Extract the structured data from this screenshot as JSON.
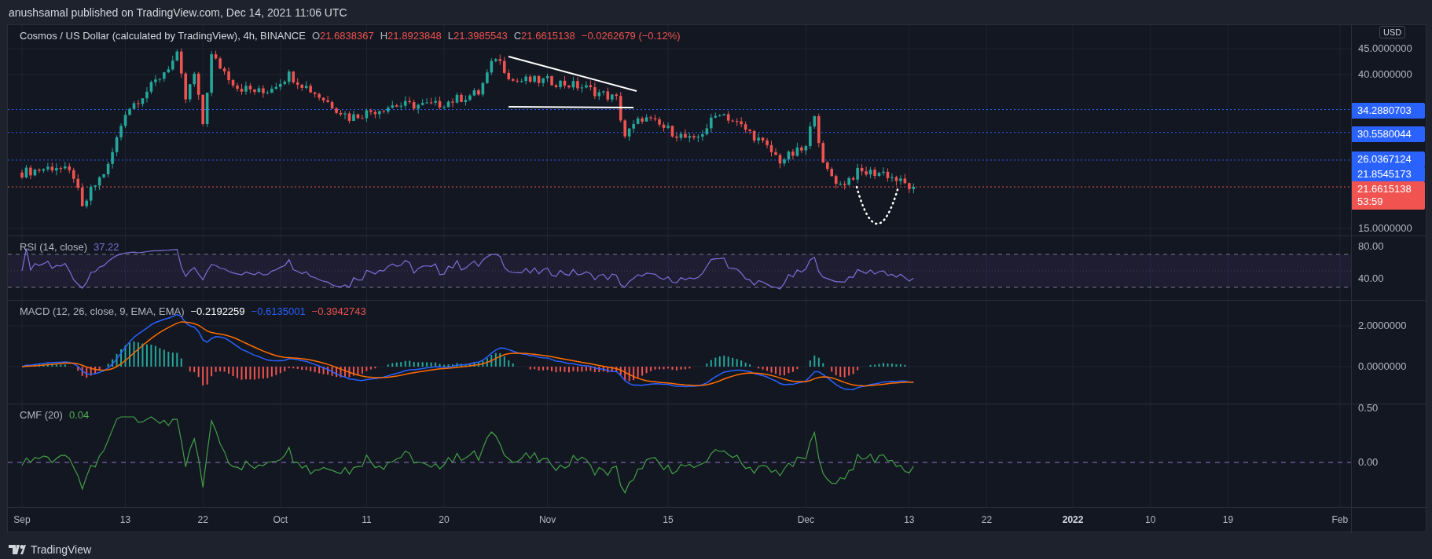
{
  "header": {
    "publisher_line": "anushsamal published on TradingView.com, Dec 14, 2021 11:06 UTC"
  },
  "price_pane": {
    "symbol": "Cosmos / US Dollar (calculated by TradingView), 4h, BINANCE",
    "ohlc": [
      {
        "label": "O",
        "value": "21.6838367"
      },
      {
        "label": "H",
        "value": "21.8923848"
      },
      {
        "label": "L",
        "value": "21.3985543"
      },
      {
        "label": "C",
        "value": "21.6615138"
      }
    ],
    "change": "−0.0262679 (−0.12%)",
    "currency": "USD",
    "ticks": [
      "45.0000000",
      "40.0000000",
      "15.0000000"
    ],
    "tags": [
      {
        "value": "34.2880703",
        "color": "#2962ff"
      },
      {
        "value": "30.5580044",
        "color": "#2962ff"
      },
      {
        "value": "26.0367124",
        "color": "#2962ff"
      },
      {
        "value": "21.8545173",
        "color": "#2962ff"
      },
      {
        "value": "21.6615138",
        "countdown": "53:59",
        "color": "#f05350"
      }
    ]
  },
  "rsi_pane": {
    "label": "RSI (14, close)",
    "value": "37.22",
    "ticks": [
      "80.00",
      "40.00"
    ]
  },
  "macd_pane": {
    "label": "MACD (12, 26, close, 9, EMA, EMA)",
    "values": [
      {
        "value": "−0.2192259",
        "color": "#ffffff"
      },
      {
        "value": "−0.6135001",
        "color": "#2962ff"
      },
      {
        "value": "−0.3942743",
        "color": "#f05350"
      }
    ],
    "ticks": [
      "2.0000000",
      "0.0000000"
    ]
  },
  "cmf_pane": {
    "label": "CMF (20)",
    "value": "0.04",
    "ticks": [
      "0.50",
      "0.00"
    ]
  },
  "time_axis": [
    {
      "label": "Sep",
      "kind": "month"
    },
    {
      "label": "13",
      "kind": "day"
    },
    {
      "label": "22",
      "kind": "day"
    },
    {
      "label": "Oct",
      "kind": "month"
    },
    {
      "label": "11",
      "kind": "day"
    },
    {
      "label": "20",
      "kind": "day"
    },
    {
      "label": "Nov",
      "kind": "month"
    },
    {
      "label": "15",
      "kind": "day"
    },
    {
      "label": "Dec",
      "kind": "month"
    },
    {
      "label": "13",
      "kind": "day"
    },
    {
      "label": "22",
      "kind": "day"
    },
    {
      "label": "2022",
      "kind": "year"
    },
    {
      "label": "10",
      "kind": "day"
    },
    {
      "label": "19",
      "kind": "day"
    },
    {
      "label": "Feb",
      "kind": "month"
    }
  ],
  "footer": {
    "brand": "TradingView"
  }
}
